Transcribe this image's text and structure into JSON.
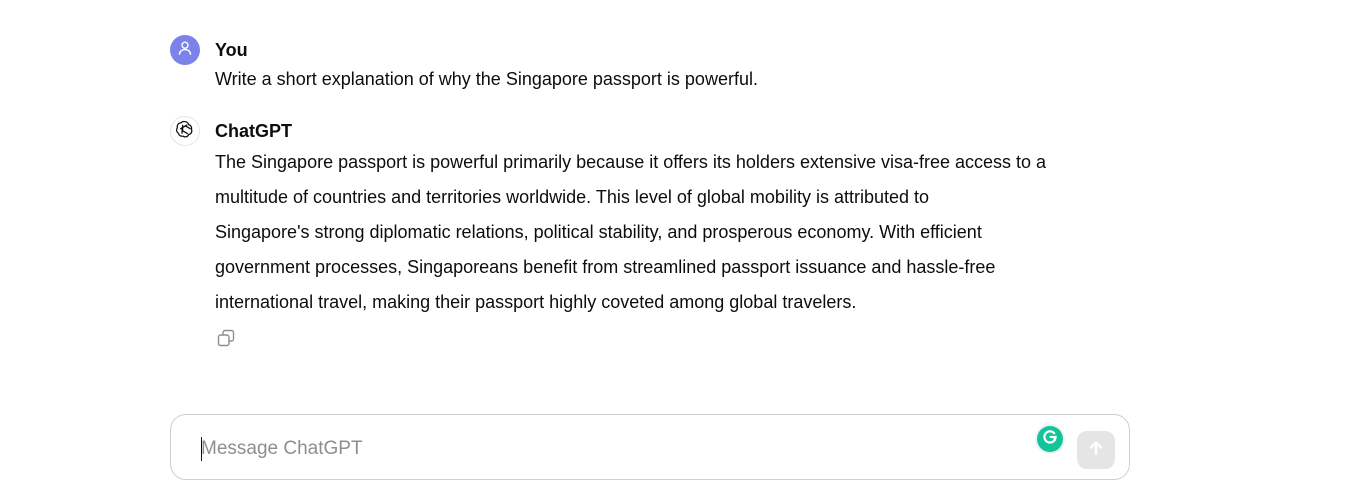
{
  "messages": {
    "user": {
      "author": "You",
      "text": "Write a short explanation of why the Singapore passport is powerful.",
      "avatar_icon": "person-icon",
      "avatar_color": "#7b83eb"
    },
    "assistant": {
      "author": "ChatGPT",
      "avatar_icon": "openai-logo-icon",
      "lines": [
        "The Singapore passport is powerful primarily because it offers its holders extensive visa-free access to a",
        "multitude of countries and territories worldwide. This level of global mobility is attributed to",
        "Singapore's strong diplomatic relations, political stability, and prosperous economy. With efficient",
        "government processes, Singaporeans benefit from streamlined passport issuance and hassle-free",
        "international travel, making their passport highly coveted among global travelers."
      ],
      "action_icon": "copy-icon"
    }
  },
  "composer": {
    "placeholder": "Message ChatGPT",
    "value": "",
    "grammarly_icon": "grammarly-icon",
    "grammarly_color": "#15c39a",
    "send_icon": "arrow-up-icon"
  }
}
